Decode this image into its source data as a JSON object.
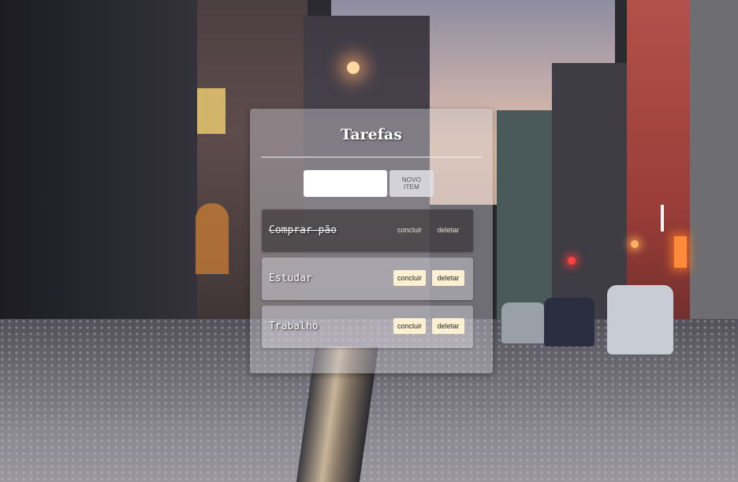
{
  "app": {
    "title": "Tarefas"
  },
  "form": {
    "input_value": "",
    "input_placeholder": "",
    "add_button_label": "NOVO ITEM"
  },
  "tasks": [
    {
      "label": "Comprar pão",
      "done": true,
      "complete_label": "concluir",
      "delete_label": "deletar"
    },
    {
      "label": "Estudar",
      "done": false,
      "complete_label": "concluir",
      "delete_label": "deletar"
    },
    {
      "label": "Trabalho",
      "done": false,
      "complete_label": "concluir",
      "delete_label": "deletar"
    }
  ],
  "colors": {
    "button_bg": "#fbf1d2",
    "card_bg": "rgba(205,205,212,0.42)"
  }
}
